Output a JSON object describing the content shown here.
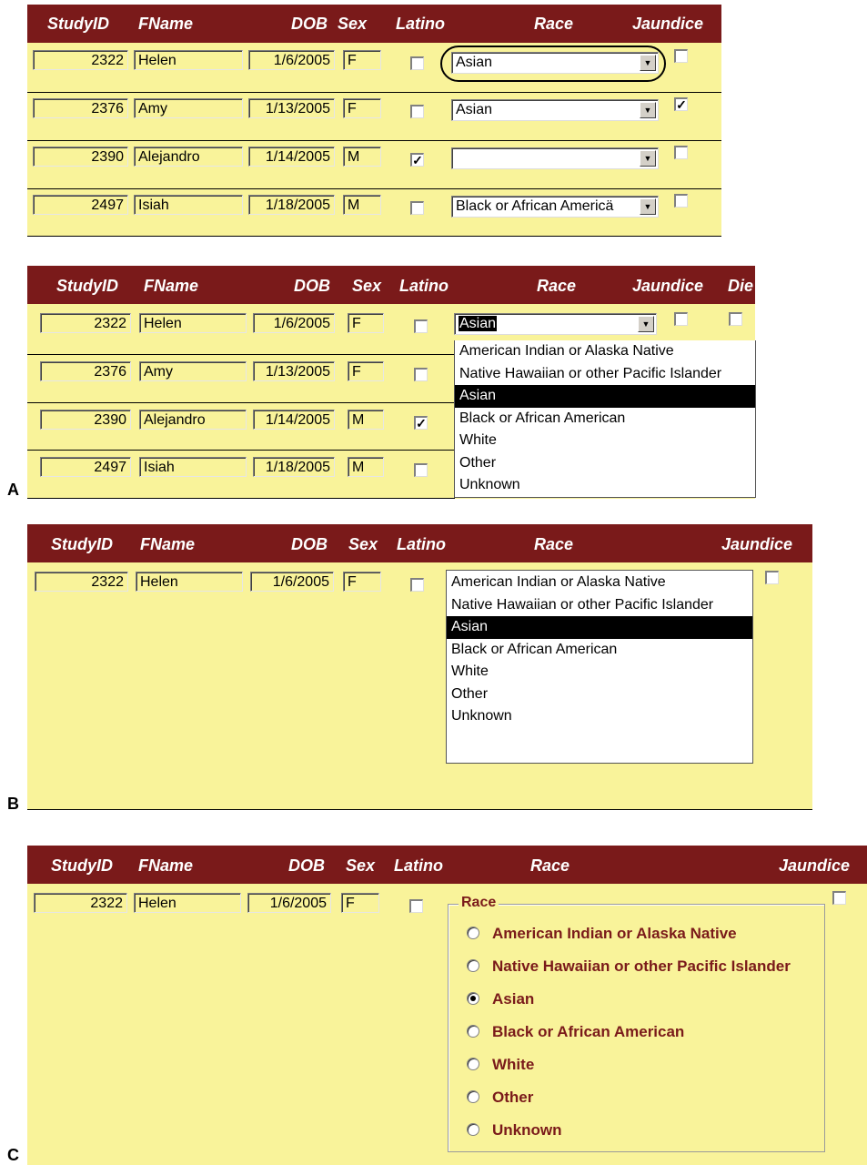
{
  "headers": {
    "study_id": "StudyID",
    "fname": "FName",
    "dob": "DOB",
    "sex": "Sex",
    "latino": "Latino",
    "race": "Race",
    "jaundice": "Jaundice",
    "die_partial": "Die"
  },
  "records": [
    {
      "study_id": "2322",
      "fname": "Helen",
      "dob": "1/6/2005",
      "sex": "F",
      "latino": false,
      "race": "Asian",
      "jaundice": false
    },
    {
      "study_id": "2376",
      "fname": "Amy",
      "dob": "1/13/2005",
      "sex": "F",
      "latino": false,
      "race": "Asian",
      "jaundice": true
    },
    {
      "study_id": "2390",
      "fname": "Alejandro",
      "dob": "1/14/2005",
      "sex": "M",
      "latino": true,
      "race": "",
      "jaundice": false
    },
    {
      "study_id": "2497",
      "fname": "Isiah",
      "dob": "1/18/2005",
      "sex": "M",
      "latino": false,
      "race": "Black or African Americä",
      "jaundice": false
    }
  ],
  "race_options": [
    "American Indian or Alaska Native",
    "Native Hawaiian or other Pacific Islander",
    "Asian",
    "Black or African American",
    "White",
    "Other",
    "Unknown"
  ],
  "selected_race": "Asian",
  "radio_group_title": "Race",
  "panel_labels": {
    "a": "A",
    "b": "B",
    "c": "C"
  },
  "colors": {
    "header_bg": "#7a1a1a",
    "form_bg": "#f9f39a",
    "radio_text": "#7a1a1a"
  }
}
